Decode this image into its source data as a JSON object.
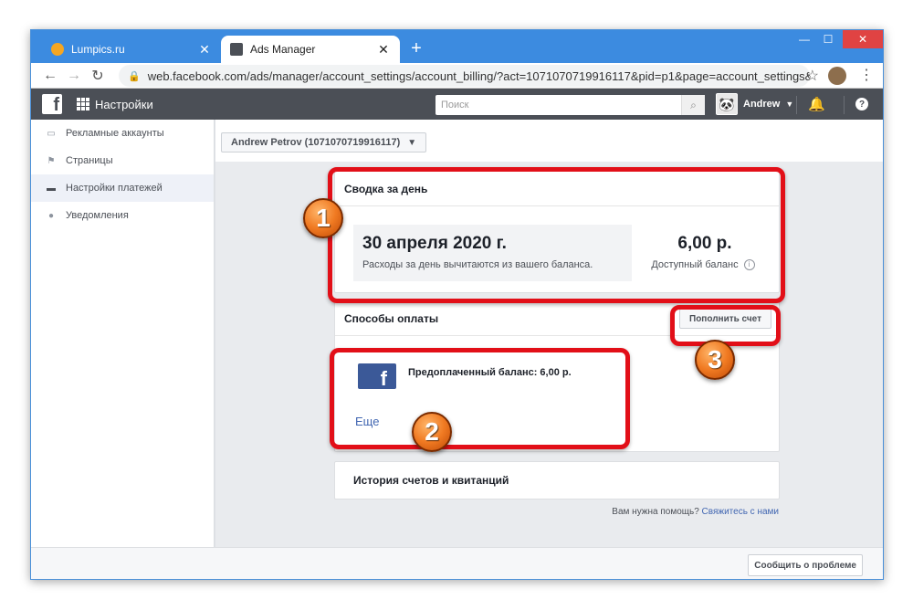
{
  "browser": {
    "tabs": [
      {
        "title": "Lumpics.ru",
        "close": "✕"
      },
      {
        "title": "Ads Manager",
        "close": "✕"
      }
    ],
    "new_tab": "+",
    "url": "web.facebook.com/ads/manager/account_settings/account_billing/?act=1071070719916117&pid=p1&page=account_settings&tab=accou...",
    "window_controls": {
      "minimize": "—",
      "maximize": "☐",
      "close": "✕"
    }
  },
  "fb_header": {
    "logo": "f",
    "title": "Настройки",
    "search_placeholder": "Поиск",
    "user_name": "Andrew",
    "help": "?"
  },
  "sidebar": {
    "items": [
      {
        "label": "Рекламные аккаунты",
        "icon": "accounts-icon"
      },
      {
        "label": "Страницы",
        "icon": "flag-icon"
      },
      {
        "label": "Настройки платежей",
        "icon": "card-icon"
      },
      {
        "label": "Уведомления",
        "icon": "globe-icon"
      }
    ],
    "active_index": 2
  },
  "account_selector": "Andrew Petrov (1071070719916117)",
  "summary": {
    "heading": "Сводка за день",
    "date": "30 апреля 2020 г.",
    "subtext": "Расходы за день вычитаются из вашего баланса.",
    "amount": "6,00 р.",
    "amount_label": "Доступный баланс",
    "info": "i"
  },
  "payment": {
    "heading": "Способы оплаты",
    "topup_label": "Пополнить счет",
    "method_icon": "f",
    "method_text": "Предоплаченный баланс: 6,00 р.",
    "more_link": "Еще"
  },
  "history": {
    "heading": "История счетов и квитанций"
  },
  "help_line": {
    "text": "Вам нужна помощь?",
    "link": "Свяжитесь с нами"
  },
  "report_button": "Сообщить о проблеме",
  "annotations": {
    "badge1": "1",
    "badge2": "2",
    "badge3": "3"
  },
  "colors": {
    "highlight": "#e20f18",
    "badge": "#f07a22",
    "fb_bar": "#4b4f56",
    "link": "#4267b2"
  }
}
